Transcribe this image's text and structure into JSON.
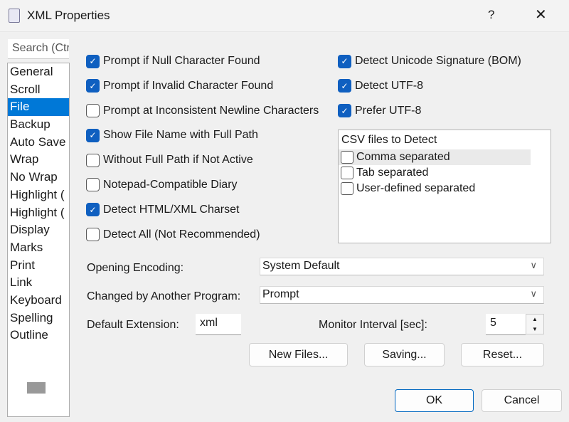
{
  "window": {
    "title": "XML Properties",
    "help": "?",
    "close": "✕"
  },
  "sidebar": {
    "search_placeholder": "Search (Ctrl",
    "items": [
      "General",
      "Scroll",
      "File",
      "Backup",
      "Auto Save",
      "Wrap",
      "No Wrap",
      "Highlight (",
      "Highlight (",
      "Display",
      "Marks",
      "Print",
      "Link",
      "Keyboard",
      "Spelling",
      "Outline"
    ],
    "selected": "File"
  },
  "left_checks": [
    {
      "label": "Prompt if Null Character Found",
      "checked": true
    },
    {
      "label": "Prompt if Invalid Character Found",
      "checked": true
    },
    {
      "label": "Prompt at Inconsistent Newline Characters",
      "checked": false
    },
    {
      "label": "Show File Name with Full Path",
      "checked": true
    },
    {
      "label": "Without Full Path if Not Active",
      "checked": false
    },
    {
      "label": "Notepad-Compatible Diary",
      "checked": false
    },
    {
      "label": "Detect HTML/XML Charset",
      "checked": true
    },
    {
      "label": "Detect All (Not Recommended)",
      "checked": false
    }
  ],
  "right_checks": [
    {
      "label": "Detect Unicode Signature (BOM)",
      "checked": true
    },
    {
      "label": "Detect UTF-8",
      "checked": true
    },
    {
      "label": "Prefer UTF-8",
      "checked": true
    }
  ],
  "csv": {
    "header": "CSV files to Detect",
    "items": [
      {
        "label": "Comma separated",
        "checked": false
      },
      {
        "label": "Tab separated",
        "checked": false
      },
      {
        "label": "User-defined separated",
        "checked": false
      }
    ]
  },
  "form": {
    "opening_label": "Opening Encoding:",
    "opening_value": "System Default",
    "changed_label": "Changed by Another Program:",
    "changed_value": "Prompt",
    "ext_label": "Default Extension:",
    "ext_value": "xml",
    "monitor_label": "Monitor Interval [sec]:",
    "monitor_value": "5"
  },
  "buttons": {
    "new_files": "New Files...",
    "saving": "Saving...",
    "reset": "Reset...",
    "ok": "OK",
    "cancel": "Cancel"
  },
  "accent": "#0f5fc0"
}
